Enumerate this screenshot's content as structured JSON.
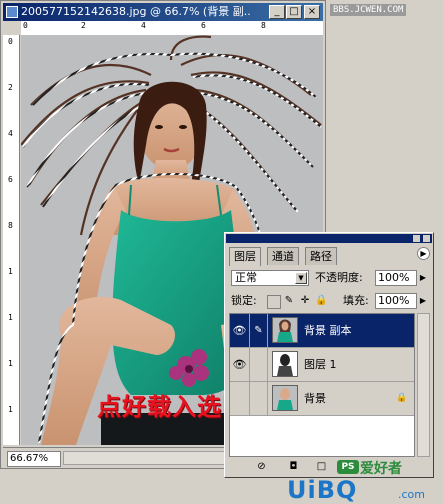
{
  "document": {
    "title": "200577152142638.jpg @ 66.7% (背景 副...",
    "ruler_top_numbers": [
      "0",
      "2",
      "4",
      "6",
      "8"
    ],
    "ruler_left_numbers": [
      "0",
      "2",
      "4",
      "6",
      "8",
      "1",
      "1",
      "1",
      "1"
    ],
    "zoom_readout": "66.67%"
  },
  "layers_panel": {
    "tabs": [
      "图层",
      "通道",
      "路径"
    ],
    "blend_mode": "正常",
    "opacity_label": "不透明度:",
    "opacity_value": "100%",
    "lock_label": "锁定:",
    "fill_label": "填充:",
    "fill_value": "100%",
    "layers": [
      {
        "name": "背景 副本",
        "visible": true,
        "selected": true,
        "locked": false
      },
      {
        "name": "图层 1",
        "visible": true,
        "selected": false,
        "locked": false
      },
      {
        "name": "背景",
        "visible": false,
        "selected": false,
        "locked": true
      }
    ]
  },
  "overlay": {
    "caption": "点好载入选区",
    "watermark_top": "BBS.JCWEN.COM",
    "ps_logo_icon": "PS",
    "ps_logo_text": "爱好者",
    "uibq_brand": "UiBQ",
    "uibq_suffix": ".com"
  },
  "colors": {
    "titlebar": "#0a246a",
    "selected_layer": "#0a246a",
    "caption": "#e8131f",
    "dress": "#17a88a",
    "brand_blue": "#1c76c8",
    "logo_green": "#2c8c3c"
  },
  "icons": [
    "eye-icon",
    "brush-icon",
    "lock-icon",
    "chain-icon",
    "new-layer-icon",
    "trash-icon",
    "layer-style-icon",
    "panel-menu-icon"
  ]
}
